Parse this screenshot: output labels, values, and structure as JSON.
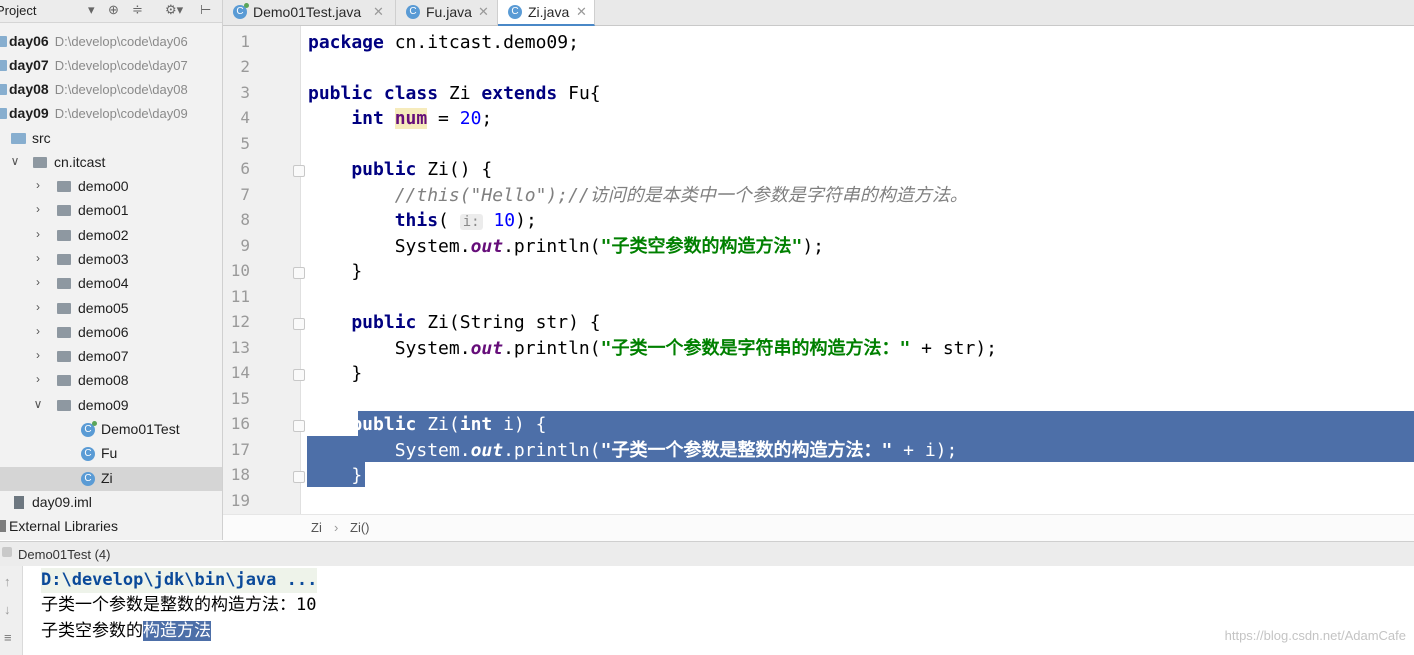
{
  "sidebar": {
    "header": "Project",
    "rows": [
      {
        "label": "day06",
        "path": "D:\\develop\\code\\day06"
      },
      {
        "label": "day07",
        "path": "D:\\develop\\code\\day07"
      },
      {
        "label": "day08",
        "path": "D:\\develop\\code\\day08"
      },
      {
        "label": "day09",
        "path": "D:\\develop\\code\\day09"
      },
      {
        "label": "src"
      },
      {
        "label": "cn.itcast"
      },
      {
        "label": "demo00"
      },
      {
        "label": "demo01"
      },
      {
        "label": "demo02"
      },
      {
        "label": "demo03"
      },
      {
        "label": "demo04"
      },
      {
        "label": "demo05"
      },
      {
        "label": "demo06"
      },
      {
        "label": "demo07"
      },
      {
        "label": "demo08"
      },
      {
        "label": "demo09"
      },
      {
        "label": "Demo01Test"
      },
      {
        "label": "Fu"
      },
      {
        "label": "Zi"
      },
      {
        "label": "day09.iml"
      },
      {
        "label": "External Libraries"
      }
    ]
  },
  "tabs": [
    {
      "label": "Demo01Test.java"
    },
    {
      "label": "Fu.java"
    },
    {
      "label": "Zi.java"
    }
  ],
  "editor": {
    "line_numbers": [
      "1",
      "2",
      "3",
      "4",
      "5",
      "6",
      "7",
      "8",
      "9",
      "10",
      "11",
      "12",
      "13",
      "14",
      "15",
      "16",
      "17",
      "18",
      "19"
    ],
    "code": {
      "l1a": "package ",
      "l1b": "cn.itcast.demo09;",
      "l3a": "public class ",
      "l3b": "Zi ",
      "l3c": "extends ",
      "l3d": "Fu{",
      "l4a": "    int ",
      "l4b": "num",
      "l4c": " = ",
      "l4d": "20",
      "l4e": ";",
      "l6a": "    public ",
      "l6b": "Zi() {",
      "l7": "        //this(\"Hello\");//访问的是本类中一个参数是字符串的构造方法。",
      "l8a": "        this",
      "l8b": "( ",
      "l8hint": "i:",
      "l8c": " ",
      "l8d": "10",
      "l8e": ");",
      "l9a": "        System.",
      "l9b": "out",
      "l9c": ".println(",
      "l9d": "\"子类空参数的构造方法\"",
      "l9e": ");",
      "l10": "    }",
      "l12a": "    public ",
      "l12b": "Zi(String str) {",
      "l13a": "        System.",
      "l13b": "out",
      "l13c": ".println(",
      "l13d": "\"子类一个参数是字符串的构造方法：\"",
      "l13e": " + str);",
      "l14": "    }",
      "l16a": "    public ",
      "l16b": "Zi(",
      "l16c": "int ",
      "l16d": "i) {",
      "l17a": "        System.",
      "l17b": "out",
      "l17c": ".println(",
      "l17d": "\"子类一个参数是整数的构造方法：\"",
      "l17e": " + i);",
      "l18": "    }"
    }
  },
  "breadcrumb": {
    "class": "Zi",
    "sep": "›",
    "method": "Zi()"
  },
  "run": {
    "title": "Demo01Test (4)",
    "lines": [
      "D:\\develop\\jdk\\bin\\java ...",
      "子类一个参数是整数的构造方法：10",
      "子类空参数的"
    ],
    "selected_tail": "构造方法"
  },
  "watermark": "https://blog.csdn.net/AdamCafe",
  "colors": {
    "selection": "#4d6fa8",
    "keyword": "#000080",
    "string": "#008000",
    "field": "#660e7a",
    "number": "#0000ff"
  }
}
